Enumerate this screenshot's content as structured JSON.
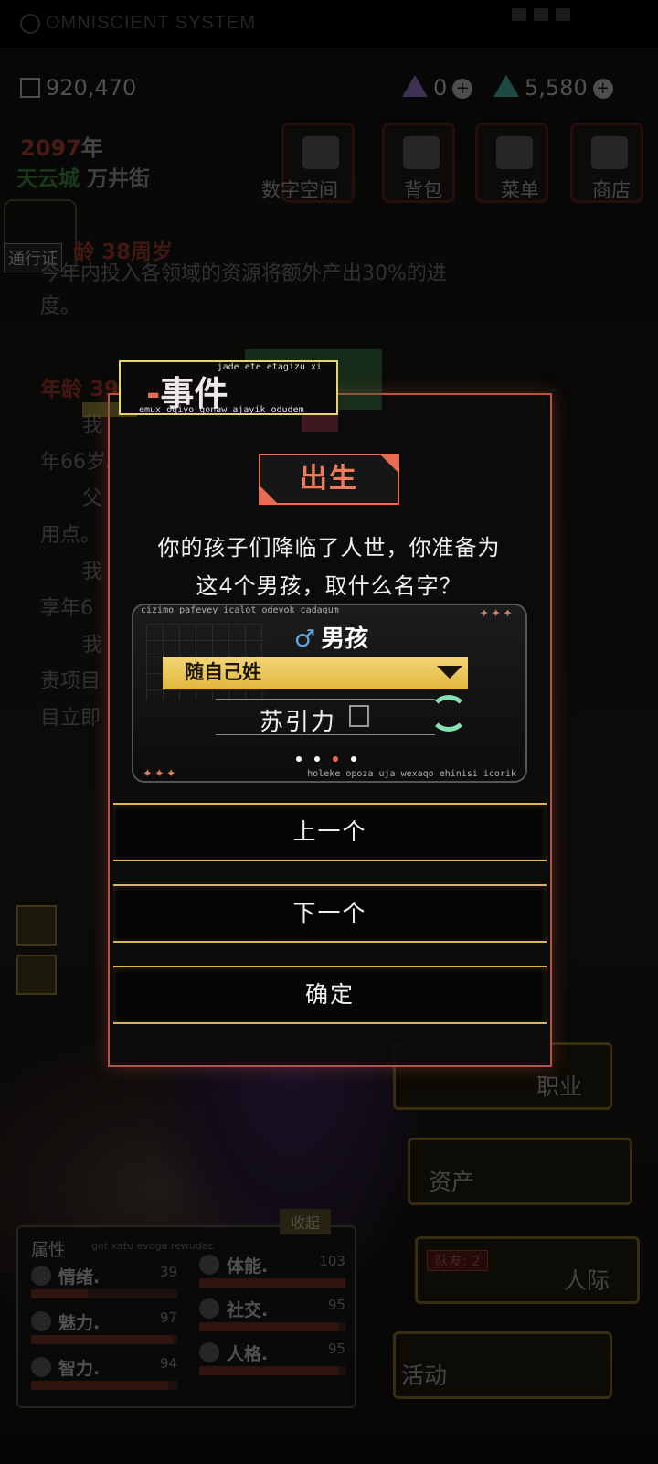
{
  "system_bar": {
    "title": "OMNISCIENT SYSTEM"
  },
  "resources": {
    "credits": "920,470",
    "gem_purple": "0",
    "gem_teal": "5,580"
  },
  "location": {
    "year": "2097",
    "year_suffix": "年",
    "city": "天云城",
    "street": "万井街"
  },
  "nav": [
    {
      "label": "数字空间",
      "icon": "digital-space-icon"
    },
    {
      "label": "背包",
      "icon": "backpack-icon"
    },
    {
      "label": "菜单",
      "icon": "menu-icon"
    },
    {
      "label": "商店",
      "icon": "cart-icon"
    }
  ],
  "pass_label": "通行证",
  "story": {
    "age1": "龄 38周岁",
    "line1": "今年内投入各领域的资源将额外产出30%的进",
    "line2": "度。",
    "age2": "年龄 39",
    "line3": "我",
    "line4": "年66岁。",
    "line5": "父",
    "line6": "用点。",
    "line7": "我",
    "line8": "享年6",
    "line9": "我",
    "line10": "责项目",
    "line11": "目立即"
  },
  "right_cards": {
    "career": "职业",
    "assets": "资产",
    "social": "人际",
    "activity": "活动",
    "teammates": "队友: 2"
  },
  "attributes": {
    "title": "属性",
    "subtitle": "get xatu evoga rewudec",
    "collapse": "收起",
    "stats": [
      {
        "name": "情绪.",
        "value": "39",
        "level": 0.39
      },
      {
        "name": "体能.",
        "value": "103",
        "level": 1.0
      },
      {
        "name": "魅力.",
        "value": "97",
        "level": 0.97
      },
      {
        "name": "社交.",
        "value": "95",
        "level": 0.95
      },
      {
        "name": "智力.",
        "value": "94",
        "level": 0.94
      },
      {
        "name": "人格.",
        "value": "95",
        "level": 0.95
      }
    ]
  },
  "dialog": {
    "event_tag": "-事件",
    "event_tag_dash": "-",
    "event_tag_word": "事件",
    "event_top_text": "jade ete etagizu xi",
    "event_bottom_text": "emux oqiyo gonaw ajayik odudem",
    "section": "出生",
    "prompt_line1": "你的孩子们降临了人世，你准备为",
    "prompt_line2": "这4个男孩，取什么名字？",
    "card_top_text": "cizimo pafevey icalot odevok cadagum",
    "card_bottom_text": "holeke opoza uja wexaqo ehinisi icorik",
    "gender_symbol": "♂",
    "gender": "男孩",
    "surname_option": "随自己姓",
    "child_name": "苏引力",
    "page_count": 4,
    "current_page": 3,
    "prev_button": "上一个",
    "next_button": "下一个",
    "confirm_button": "确定"
  },
  "colors": {
    "accent": "#ea6b52",
    "gold": "#e1b63e",
    "refresh": "#88e1b2"
  }
}
